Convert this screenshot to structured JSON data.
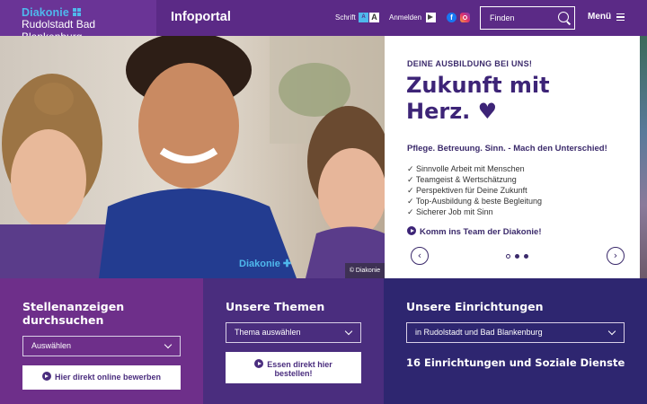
{
  "header": {
    "logo_brand": "Diakonie",
    "logo_sub": "Rudolstadt Bad Blankenburg",
    "portal_title": "Infoportal",
    "font_label": "Schrift",
    "font_small_glyph": "A",
    "font_large_glyph": "A",
    "login_label": "Anmelden",
    "facebook_glyph": "f",
    "search_placeholder": "Finden",
    "menu_label": "Menü"
  },
  "hero": {
    "photo_credit": "© Diakonie",
    "eyebrow": "DEINE AUSBILDUNG BEI UNS!",
    "headline": "Zukunft mit Herz. ♥",
    "tagline": "Pflege. Betreuung. Sinn. - Mach den Unterschied!",
    "benefits": [
      "✓ Sinnvolle Arbeit mit Menschen",
      "✓ Teamgeist & Wertschätzung",
      "✓ Perspektiven für Deine Zukunft",
      "✓ Top-Ausbildung & beste Begleitung",
      "✓ Sicherer Job mit Sinn"
    ],
    "cta": "Komm ins Team der Diakonie!",
    "prev_glyph": "‹",
    "next_glyph": "›"
  },
  "panels": {
    "jobs": {
      "title": "Stellenanzeigen durchsuchen",
      "select_value": "Auswählen",
      "button": "Hier direkt online bewerben"
    },
    "topics": {
      "title": "Unsere Themen",
      "select_value": "Thema auswählen",
      "button": "Essen direkt hier bestellen!"
    },
    "facilities": {
      "title": "Unsere Einrichtungen",
      "select_value": "in Rudolstadt und Bad Blankenburg",
      "summary": "16 Einrichtungen und Soziale Dienste"
    }
  },
  "colors": {
    "header_bg": "#5b2a86",
    "logo_blue": "#4fb8ec",
    "panel_jobs": "#6e2f8a",
    "panel_topics": "#4a2d7e",
    "panel_facilities": "#2e2670",
    "headline": "#3d2477"
  }
}
